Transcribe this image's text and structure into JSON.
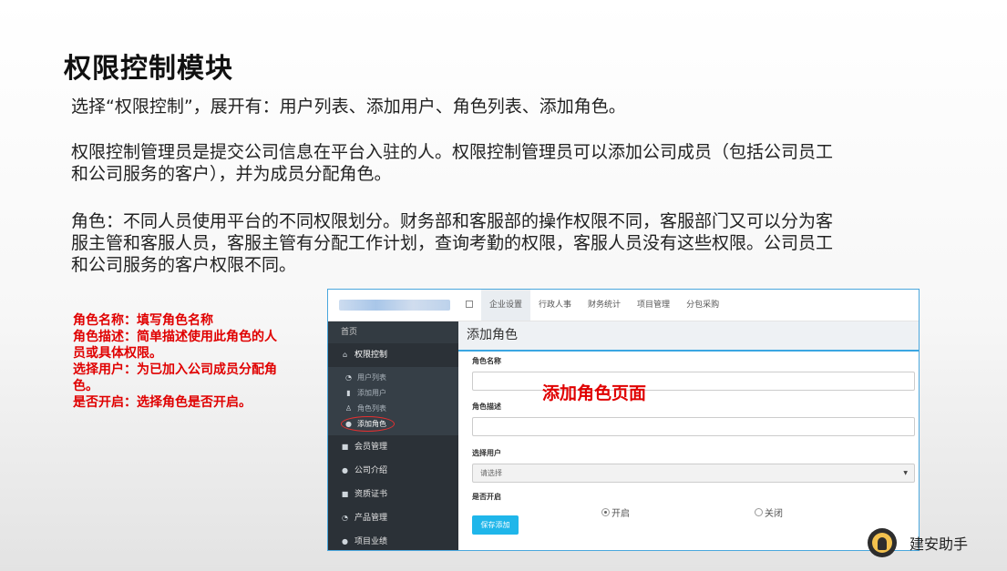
{
  "slide": {
    "title": "权限控制模块",
    "paragraphs": [
      "选择“权限控制”，展开有：用户列表、添加用户、角色列表、添加角色。",
      "权限控制管理员是提交公司信息在平台入驻的人。权限控制管理员可以添加公司成员（包括公司员工和公司服务的客户），并为成员分配角色。",
      "角色：不同人员使用平台的不同权限划分。财务部和客服部的操作权限不同，客服部门又可以分为客服主管和客服人员，客服主管有分配工作计划，查询考勤的权限，客服人员没有这些权限。公司员工和公司服务的客户权限不同。"
    ],
    "notes": [
      "角色名称：填写角色名称",
      "角色描述：简单描述使用此角色的人员或具体权限。",
      "选择用户：为已加入公司成员分配角色。",
      "是否开启：选择角色是否开启。"
    ],
    "page_label": "添加角色页面",
    "brand": "建安助手"
  },
  "app": {
    "topnav": [
      "企业设置",
      "行政人事",
      "财务统计",
      "项目管理",
      "分包采购"
    ],
    "sidebar": {
      "home": "首页",
      "group": "权限控制",
      "subitems": [
        "用户列表",
        "添加用户",
        "角色列表",
        "添加角色"
      ],
      "items": [
        "会员管理",
        "公司介绍",
        "资质证书",
        "产品管理",
        "项目业绩"
      ]
    },
    "content": {
      "title": "添加角色",
      "role_name_label": "角色名称",
      "role_desc_label": "角色描述",
      "select_user_label": "选择用户",
      "select_placeholder": "请选择",
      "enabled_label": "是否开启",
      "radio_on": "开启",
      "radio_off": "关闭",
      "save_button": "保存添加"
    }
  }
}
